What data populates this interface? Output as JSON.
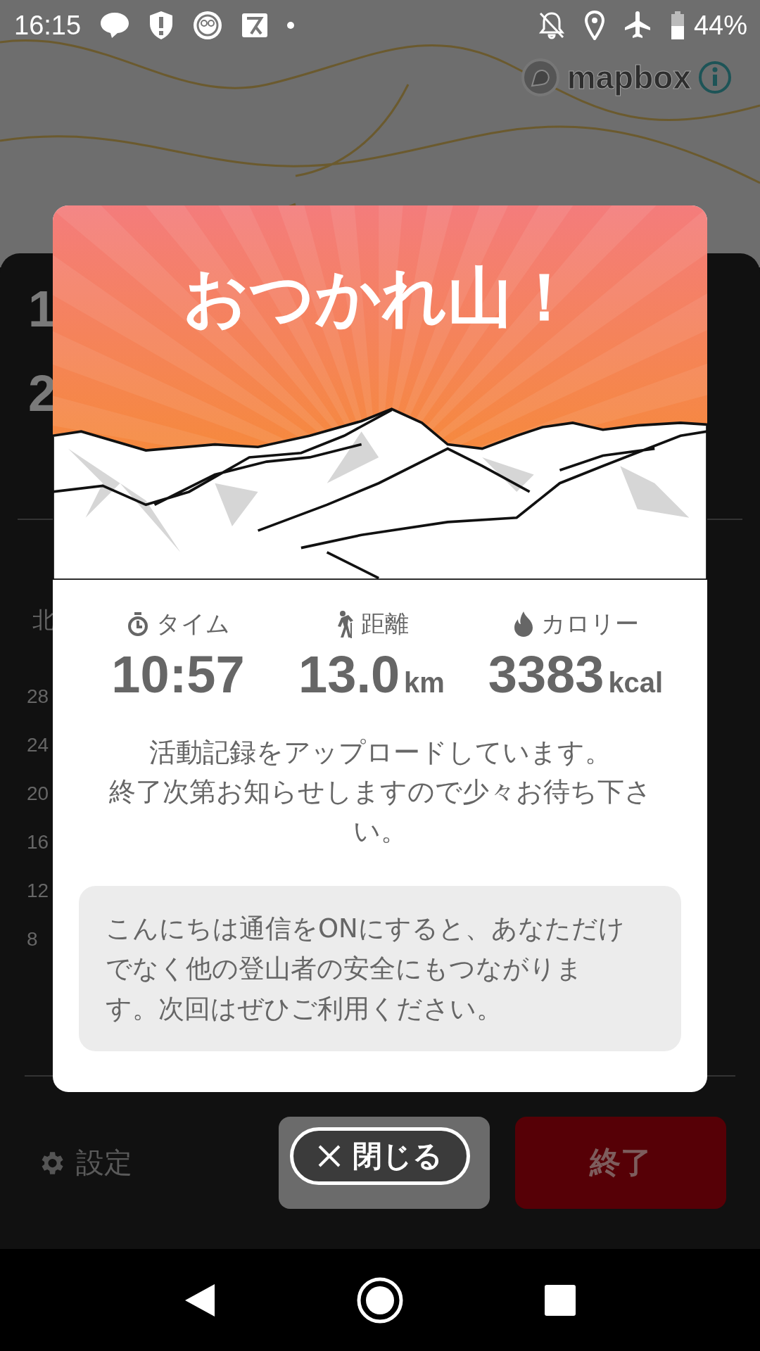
{
  "status_bar": {
    "time": "16:15",
    "battery": "44%"
  },
  "map": {
    "attribution": "mapbox"
  },
  "background_panel": {
    "fragments": [
      "1",
      "2"
    ],
    "chart_label": "北",
    "y_axis": [
      "28",
      "24",
      "20",
      "16",
      "12",
      "8"
    ]
  },
  "dialog": {
    "title": "おつかれ山！",
    "stats": [
      {
        "kind": "time",
        "label": "タイム",
        "value": "10:57"
      },
      {
        "kind": "distance",
        "label": "距離",
        "value": "13.0",
        "unit": "km"
      },
      {
        "kind": "calories",
        "label": "カロリー",
        "value": "3383",
        "unit": "kcal"
      }
    ],
    "message_lines": [
      "活動記録をアップロードしています。",
      "終了次第お知らせしますので少々お待ち下さい。"
    ],
    "notice": "こんにちは通信をONにすると、あなただけでなく他の登山者の安全にもつながります。次回はぜひご利用ください。"
  },
  "close_button": "閉じる",
  "bottom_bar": {
    "settings": "設定",
    "end": "終了"
  }
}
